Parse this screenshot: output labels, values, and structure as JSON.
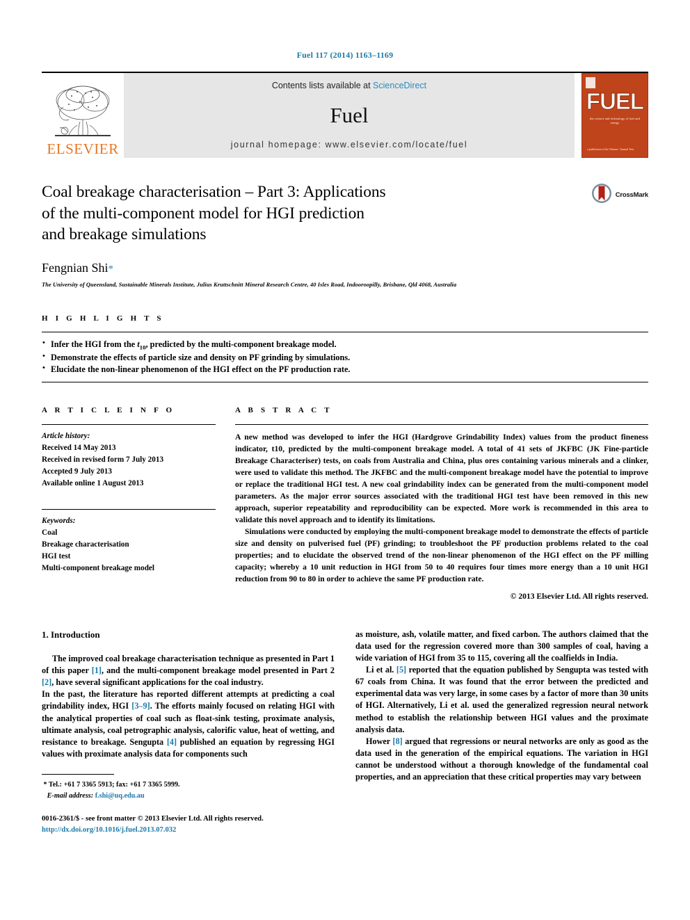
{
  "journal_ref": "Fuel 117 (2014) 1163–1169",
  "masthead": {
    "contents_prefix": "Contents lists available at ",
    "sciencedirect": "ScienceDirect",
    "journal_title": "Fuel",
    "homepage": "journal homepage: www.elsevier.com/locate/fuel",
    "publisher_wordmark": "ELSEVIER",
    "cover_title": "FUEL",
    "cover_subtitle": "the science and technology of fuel and energy",
    "cover_footer": "a publication of the\nVolume / Journal Text"
  },
  "article": {
    "title_line1": "Coal breakage characterisation – Part 3: Applications",
    "title_line2": "of the multi-component model for HGI prediction",
    "title_line3": "and breakage simulations",
    "crossmark_label": "CrossMark",
    "author": "Fengnian Shi",
    "author_marker": "*",
    "affiliation": "The University of Queensland, Sustainable Minerals Institute, Julius Kruttschnitt Mineral Research Centre, 40 Isles Road, Indooroopilly, Brisbane, Qld 4068, Australia"
  },
  "highlights": {
    "heading": "H I G H L I G H T S",
    "items": [
      "Infer the HGI from the t10, predicted by the multi-component breakage model.",
      "Demonstrate the effects of particle size and density on PF grinding by simulations.",
      "Elucidate the non-linear phenomenon of the HGI effect on the PF production rate."
    ]
  },
  "article_info": {
    "heading": "A R T I C L E   I N F O",
    "history_label": "Article history:",
    "history": [
      "Received 14 May 2013",
      "Received in revised form 7 July 2013",
      "Accepted 9 July 2013",
      "Available online 1 August 2013"
    ],
    "keywords_label": "Keywords:",
    "keywords": [
      "Coal",
      "Breakage characterisation",
      "HGI test",
      "Multi-component breakage model"
    ]
  },
  "abstract": {
    "heading": "A B S T R A C T",
    "paragraph1": "A new method was developed to infer the HGI (Hardgrove Grindability Index) values from the product fineness indicator, t10, predicted by the multi-component breakage model. A total of 41 sets of JKFBC (JK Fine-particle Breakage Characteriser) tests, on coals from Australia and China, plus ores containing various minerals and a clinker, were used to validate this method. The JKFBC and the multi-component breakage model have the potential to improve or replace the traditional HGI test. A new coal grindability index can be generated from the multi-component model parameters. As the major error sources associated with the traditional HGI test have been removed in this new approach, superior repeatability and reproducibility can be expected. More work is recommended in this area to validate this novel approach and to identify its limitations.",
    "paragraph2": "Simulations were conducted by employing the multi-component breakage model to demonstrate the effects of particle size and density on pulverised fuel (PF) grinding; to troubleshoot the PF production problems related to the coal properties; and to elucidate the observed trend of the non-linear phenomenon of the HGI effect on the PF milling capacity; whereby a 10 unit reduction in HGI from 50 to 40 requires four times more energy than a 10 unit HGI reduction from 90 to 80 in order to achieve the same PF production rate.",
    "copyright": "© 2013 Elsevier Ltd. All rights reserved."
  },
  "introduction": {
    "heading": "1. Introduction",
    "left": {
      "p1_part1": "The improved coal breakage characterisation technique as presented in Part 1 of this paper ",
      "p1_ref1": "[1]",
      "p1_part2": ", and the multi-component breakage model presented in Part 2 ",
      "p1_ref2": "[2]",
      "p1_part3": ", have several significant applications for the coal industry.",
      "p2_part1": "In the past, the literature has reported different attempts at predicting a coal grindability index, HGI ",
      "p2_ref1": "[3–9]",
      "p2_part2": ". The efforts mainly focused on relating HGI with the analytical properties of coal such as float-sink testing, proximate analysis, ultimate analysis, coal petrographic analysis, calorific value, heat of wetting, and resistance to breakage. Sengupta ",
      "p2_ref2": "[4]",
      "p2_part3": " published an equation by regressing HGI values with proximate analysis data for components such"
    },
    "right": {
      "p1": "as moisture, ash, volatile matter, and fixed carbon. The authors claimed that the data used for the regression covered more than 300 samples of coal, having a wide variation of HGI from 35 to 115, covering all the coalfields in India.",
      "p2_part1": "Li et al. ",
      "p2_ref1": "[5]",
      "p2_part2": " reported that the equation published by Sengupta was tested with 67 coals from China. It was found that the error between the predicted and experimental data was very large, in some cases by a factor of more than 30 units of HGI. Alternatively, Li et al. used the generalized regression neural network method to establish the relationship between HGI values and the proximate analysis data.",
      "p3_part1": "Hower ",
      "p3_ref1": "[8]",
      "p3_part2": " argued that regressions or neural networks are only as good as the data used in the generation of the empirical equations. The variation in HGI cannot be understood without a thorough knowledge of the fundamental coal properties, and an appreciation that these critical properties may vary between"
    }
  },
  "footnote": {
    "marker": "*",
    "tel": "Tel.: +61 7 3365 5913; fax: +61 7 3365 5999.",
    "email_label": "E-mail address:",
    "email": "f.shi@uq.edu.au"
  },
  "imprint": {
    "line1": "0016-2361/$ - see front matter © 2013 Elsevier Ltd. All rights reserved.",
    "doi": "http://dx.doi.org/10.1016/j.fuel.2013.07.032"
  },
  "colors": {
    "link_blue": "#1a7aa8",
    "elsevier_orange": "#E87722",
    "cover_orange": "#C0441B",
    "banner_gray": "#e6e6e6"
  }
}
